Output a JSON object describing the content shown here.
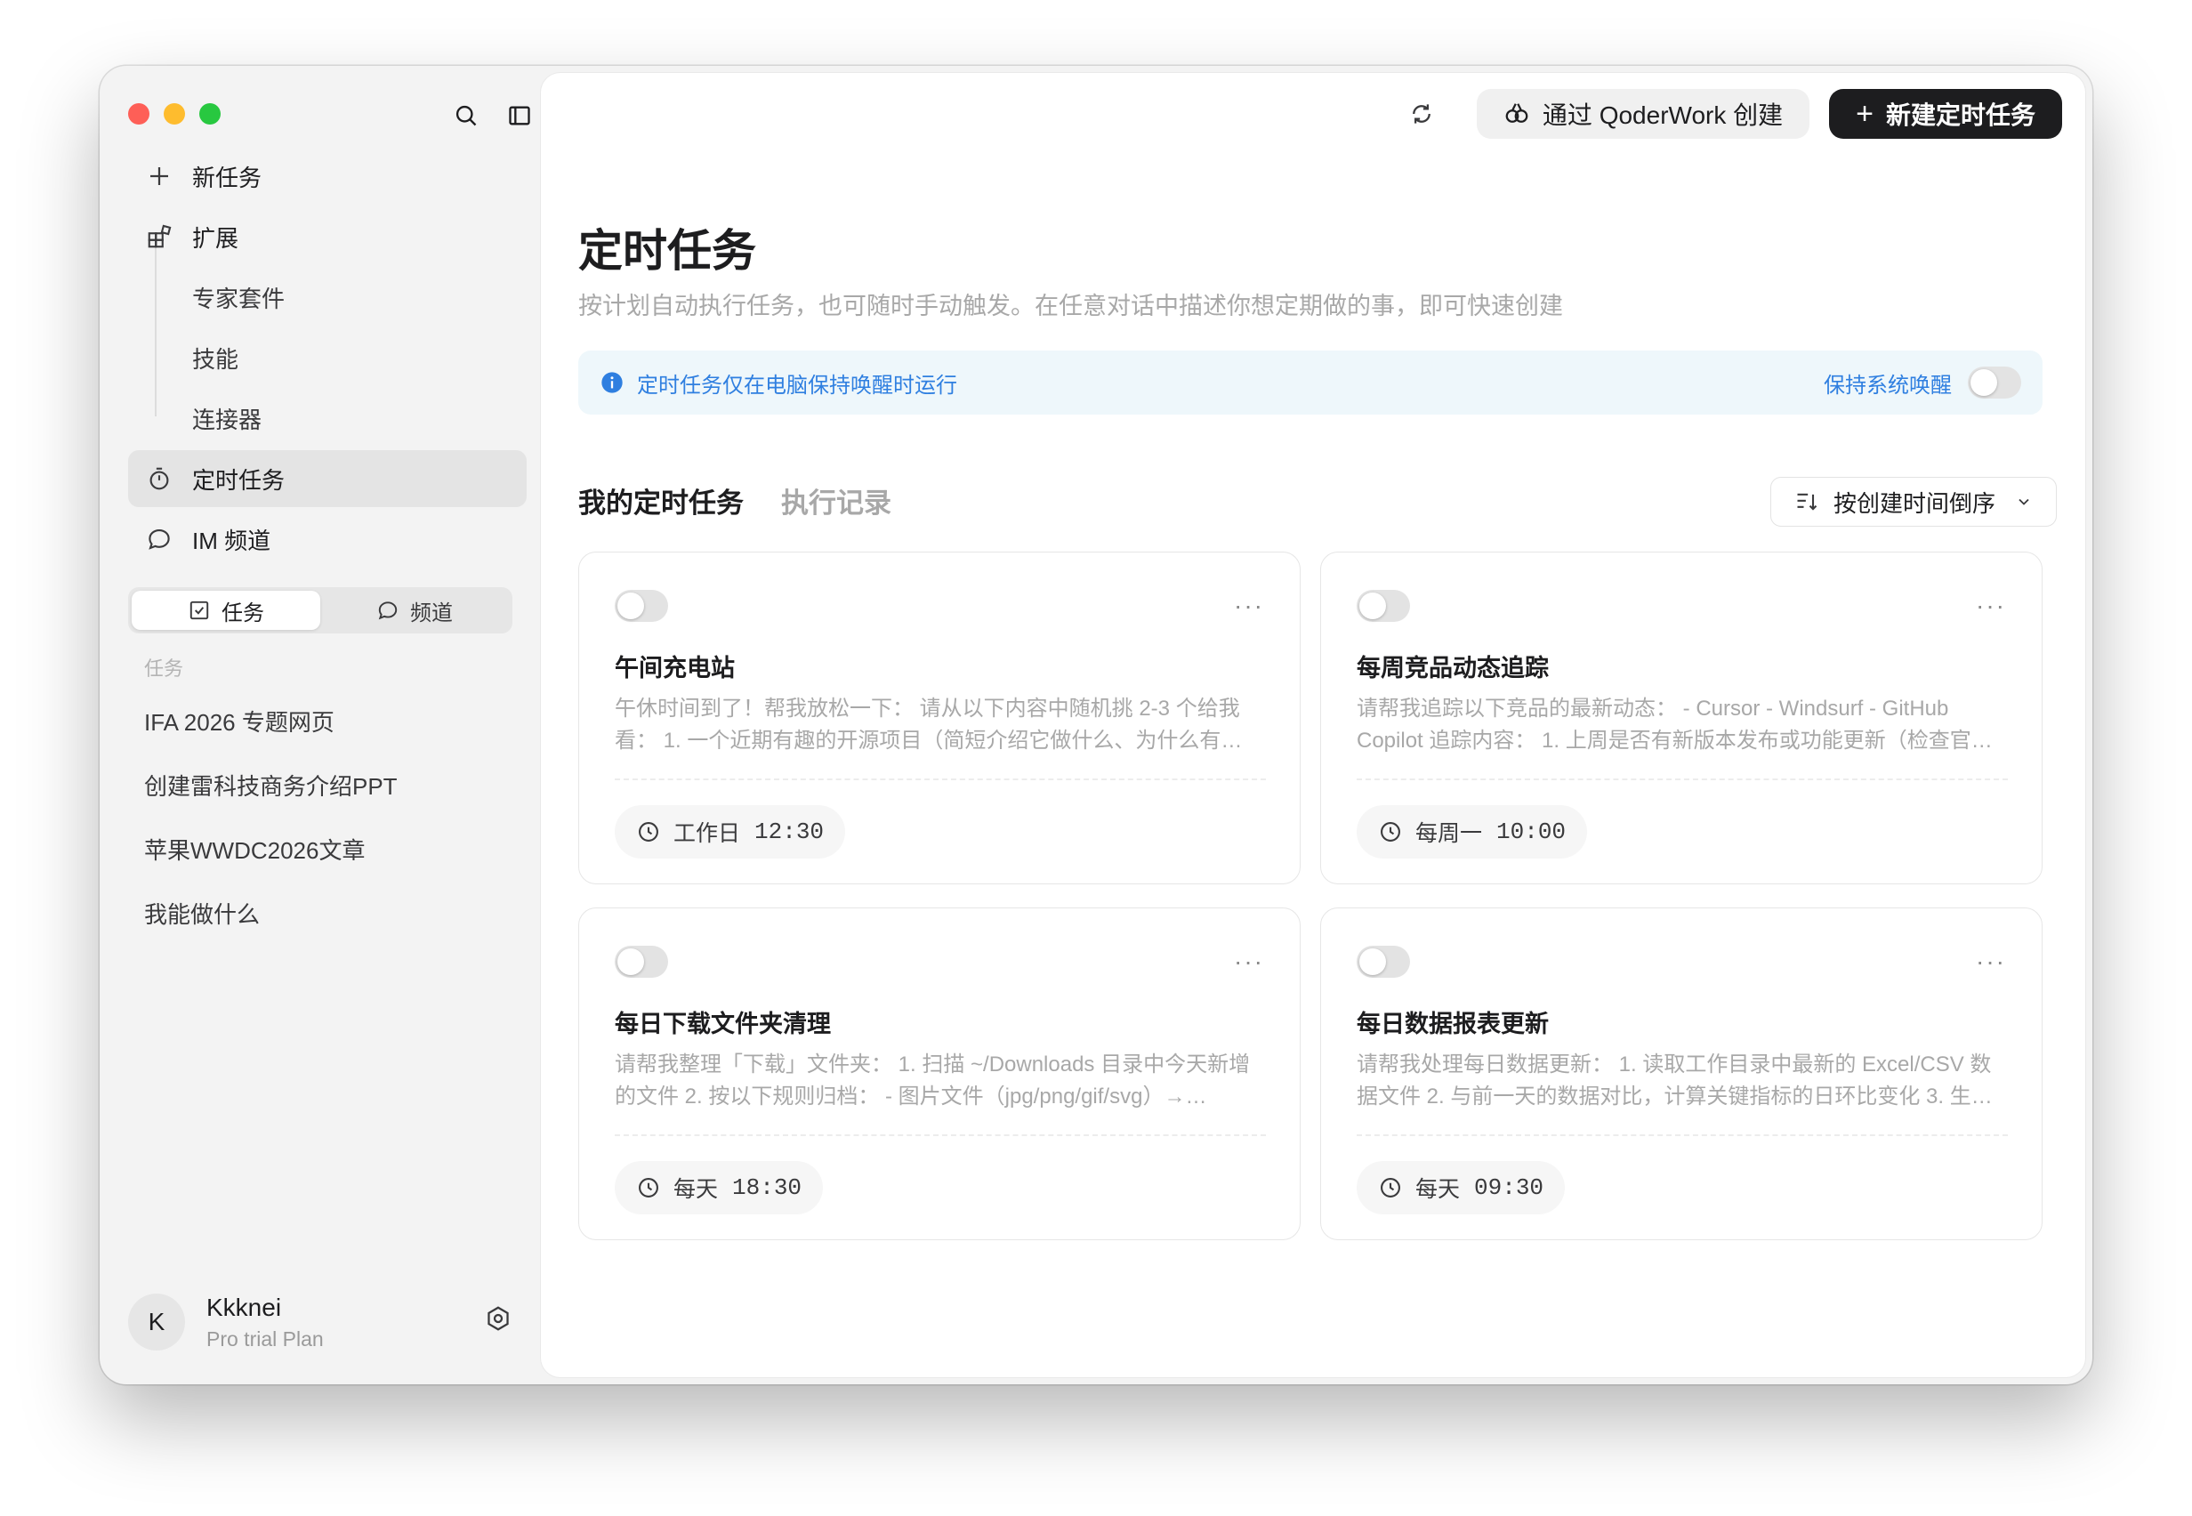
{
  "sidebar": {
    "nav": {
      "new_task": "新任务",
      "extensions": "扩展",
      "expert_kit": "专家套件",
      "skills": "技能",
      "connectors": "连接器",
      "scheduled": "定时任务",
      "im_channel": "IM 频道"
    },
    "segment": {
      "tasks": "任务",
      "channels": "频道"
    },
    "section_label": "任务",
    "tasks": [
      "IFA 2026 专题网页",
      "创建雷科技商务介绍PPT",
      "苹果WWDC2026文章",
      "我能做什么"
    ],
    "user": {
      "initial": "K",
      "name": "Kkknei",
      "plan": "Pro trial Plan"
    }
  },
  "topbar": {
    "create_via": "通过 QoderWork 创建",
    "new_scheduled": "新建定时任务",
    "plus": "+"
  },
  "page": {
    "title": "定时任务",
    "subtitle": "按计划自动执行任务，也可随时手动触发。在任意对话中描述你想定期做的事，即可快速创建",
    "banner_text": "定时任务仅在电脑保持唤醒时运行",
    "keep_awake": "保持系统唤醒",
    "tab_mine": "我的定时任务",
    "tab_history": "执行记录",
    "sort_label": "按创建时间倒序"
  },
  "cards": [
    {
      "title": "午间充电站",
      "desc": "午休时间到了！帮我放松一下：  请从以下内容中随机挑 2-3 个给我看：  1. 一个近期有趣的开源项目（简短介绍它做什么、为什么有…",
      "schedule_day": "工作日",
      "schedule_time": "12:30"
    },
    {
      "title": "每周竞品动态追踪",
      "desc": "请帮我追踪以下竞品的最新动态：  - Cursor - Windsurf - GitHub Copilot 追踪内容：  1. 上周是否有新版本发布或功能更新（检查官…",
      "schedule_day": "每周一",
      "schedule_time": "10:00"
    },
    {
      "title": "每日下载文件夹清理",
      "desc": "请帮我整理「下载」文件夹：  1. 扫描 ~/Downloads 目录中今天新增的文件 2. 按以下规则归档：  - 图片文件（jpg/png/gif/svg）→…",
      "schedule_day": "每天",
      "schedule_time": "18:30"
    },
    {
      "title": "每日数据报表更新",
      "desc": "请帮我处理每日数据更新：  1. 读取工作目录中最新的 Excel/CSV 数据文件 2. 与前一天的数据对比，计算关键指标的日环比变化 3. 生…",
      "schedule_day": "每天",
      "schedule_time": "09:30"
    }
  ],
  "more_glyph": "···",
  "colors": {
    "accent_blue": "#2f7fe0",
    "banner_bg": "#eef7fb",
    "primary_dark": "#1d1d1f",
    "sidebar_bg": "#f3f3f3"
  }
}
